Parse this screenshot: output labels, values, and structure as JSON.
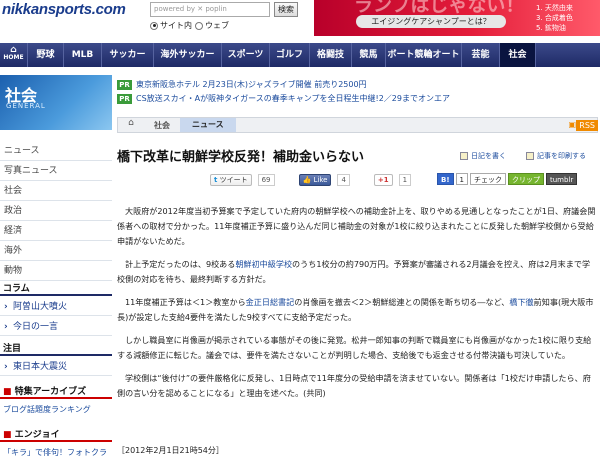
{
  "header": {
    "logo": "nikkansports.com",
    "search_placeholder": "powered by ✕ poplin",
    "search_button": "検索",
    "radio_site": "サイト内",
    "radio_web": "ウェブ"
  },
  "banner": {
    "big_text": "ランプはじゃない！",
    "sub": "エイジングケアシャンプーとは？",
    "list": [
      "1. 天然由来",
      "3. 合成着色",
      "5. 鉱物油"
    ]
  },
  "nav": {
    "home": "HOME",
    "items": [
      "野球",
      "MLB",
      "サッカー",
      "海外サッカー",
      "スポーツ",
      "ゴルフ",
      "格闘技",
      "競馬",
      "ボート競輪オート",
      "芸能",
      "社会"
    ]
  },
  "sidebar": {
    "title": "社会",
    "subtitle": "GENERAL",
    "items": [
      "ニュース",
      "写真ニュース",
      "社会",
      "政治",
      "経済",
      "海外",
      "動物"
    ],
    "column_header": "コラム",
    "column_items": [
      "阿曽山大噴火",
      "今日の一言"
    ],
    "attention_header": "注目",
    "attention_items": [
      "東日本大震災"
    ],
    "archive_header": "特集アーカイブズ",
    "archive_items": [
      "ブログ話題度ランキング"
    ],
    "enjoy_header": "エンジョイ",
    "enjoy_items": [
      "「キラ」で俳句！フォトクラ"
    ]
  },
  "pr": [
    {
      "badge": "PR",
      "text": "東京新阪急ホテル 2月23日(木)ジャズライブ開催 前売り2500円"
    },
    {
      "badge": "PR",
      "text": "CS放送スカイ・Aが阪神タイガースの春季キャンプを全日程生中継!2／29までオンエア"
    }
  ],
  "breadcrumb": {
    "level1": "社会",
    "current": "ニュース"
  },
  "rss": "RSS",
  "article": {
    "title": "橋下改革に朝鮮学校反発！補助金いらない",
    "action_diary": "日記を書く",
    "action_print": "記事を印刷する",
    "tweet_label": "ツイート",
    "tweet_count": "69",
    "like_label": "Like",
    "like_count": "4",
    "plusone_label": "+1",
    "plusone_count": "1",
    "hatena_b": "B!",
    "hatena_count": "1",
    "check": "チェック",
    "clip": "クリップ",
    "tumblr": "tumblr",
    "p1": "大阪府が2012年度当初予算案で予定していた府内の朝鮮学校への補助金計上を、取りやめる見通しとなったことが1日、府議会関係者への取材で分かった。11年度補正予算に盛り込んだ同じ補助金の対象が1校に絞り込まれたことに反発した朝鮮学校側から受給申請がないためだ。",
    "p2a": "計上予定だったのは、9校ある",
    "p2link": "朝鮮初中級学校",
    "p2b": "のうち1校分の約790万円。予算案が審議される2月議会を控え、府は2月末まで学校側の対応を待ち、最終判断する方針だ。",
    "p3a": "11年度補正予算は＜1＞教室から",
    "p3link1": "金正日総書記",
    "p3b": "の肖像画を撤去＜2＞朝鮮総連との関係を断ち切る―など、",
    "p3link2": "橋下徹",
    "p3c": "前知事(現大阪市長)が設定した支給4要件を満たした9校すべてに支給予定だった。",
    "p4": "しかし職員室に肖像画が掲示されている事態がその後に発覚。松井一郎知事の判断で職員室にも肖像画がなかった1校に限り支給する減額修正に転じた。議会では、要件を満たさないことが判明した場合、支給後でも返金させる付帯決議も可決していた。",
    "p5": "学校側は“後付け”の要件厳格化に反発し、1日時点で11年度分の受給申請を済ませていない。関係者は「1校だけ申請したら、府側の言い分を認めることになる」と理由を述べた。(共同)",
    "dateline": "［2012年2月1日21時54分］"
  }
}
